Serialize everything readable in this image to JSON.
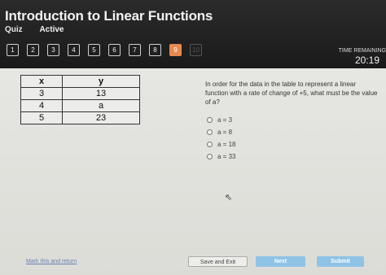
{
  "header": {
    "title": "Introduction to Linear Functions",
    "quiz_label": "Quiz",
    "status": "Active",
    "questions": [
      "1",
      "2",
      "3",
      "4",
      "5",
      "6",
      "7",
      "8",
      "9",
      "10"
    ],
    "current_question": "9",
    "timer_label": "TIME REMAINING",
    "timer_value": "20:19"
  },
  "table": {
    "headers": [
      "x",
      "y"
    ],
    "rows": [
      [
        "3",
        "13"
      ],
      [
        "4",
        "a"
      ],
      [
        "5",
        "23"
      ]
    ]
  },
  "question": {
    "text": "In order for the data in the table to represent a linear function with a rate of change of +5, what must be the value of a?",
    "options": [
      "a = 3",
      "a = 8",
      "a = 18",
      "a = 33"
    ]
  },
  "footer": {
    "mark_link": "Mark this and return",
    "save_exit": "Save and Exit",
    "next": "Next",
    "submit": "Submit"
  },
  "colors": {
    "header_bg": "#1f1f1f",
    "current_question": "#e9894f",
    "primary_button": "#8fc3e6"
  }
}
